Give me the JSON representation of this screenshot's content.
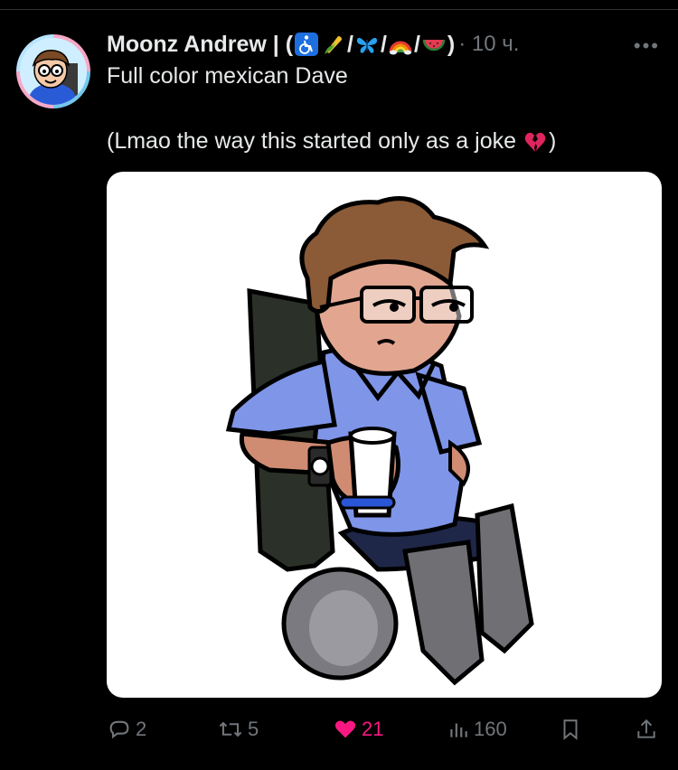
{
  "post": {
    "author_name_prefix": "Moonz Andrew | (",
    "sep1": "/",
    "sep2": "/",
    "sep3": "/",
    "author_name_suffix": ")",
    "time": "· 10 ч.",
    "more": "•••",
    "text_line1": "Full color mexican Dave",
    "text_line2": "(Lmao the way this started only as a joke",
    "text_line2_end": ")",
    "emoji_names": [
      "wheelchair-icon",
      "corn-icon",
      "butterfly-icon",
      "rainbow-icon",
      "watermelon-icon",
      "broken-heart-icon"
    ]
  },
  "actions": {
    "replies": "2",
    "reposts": "5",
    "likes": "21",
    "views": "160"
  },
  "colors": {
    "background": "#000000",
    "text": "#e7e9ea",
    "muted": "#71767b",
    "like": "#f91880",
    "media_bg": "#ffffff"
  }
}
